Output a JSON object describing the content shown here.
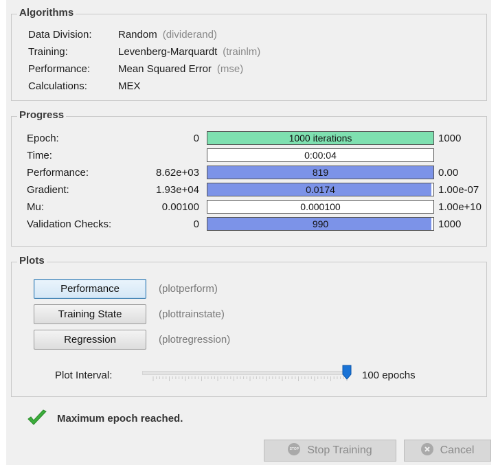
{
  "algorithms": {
    "title": "Algorithms",
    "rows": [
      {
        "key": "Data Division:",
        "value": "Random",
        "code": "(dividerand)"
      },
      {
        "key": "Training:",
        "value": "Levenberg-Marquardt",
        "code": "(trainlm)"
      },
      {
        "key": "Performance:",
        "value": "Mean Squared Error",
        "code": "(mse)"
      },
      {
        "key": "Calculations:",
        "value": "MEX",
        "code": ""
      }
    ]
  },
  "progress": {
    "title": "Progress",
    "rows": [
      {
        "label": "Epoch:",
        "start": "0",
        "bar_text": "1000 iterations",
        "end": "1000",
        "fill_fraction": 1.0,
        "fill_color": "#7ee0b0"
      },
      {
        "label": "Time:",
        "start": "",
        "bar_text": "0:00:04",
        "end": "",
        "fill_fraction": 0.0,
        "fill_color": "#ffffff"
      },
      {
        "label": "Performance:",
        "start": "8.62e+03",
        "bar_text": "819",
        "end": "0.00",
        "fill_fraction": 1.0,
        "fill_color": "#7c93e8"
      },
      {
        "label": "Gradient:",
        "start": "1.93e+04",
        "bar_text": "0.0174",
        "end": "1.00e-07",
        "fill_fraction": 0.99,
        "fill_color": "#7c93e8"
      },
      {
        "label": "Mu:",
        "start": "0.00100",
        "bar_text": "0.000100",
        "end": "1.00e+10",
        "fill_fraction": 0.0,
        "fill_color": "#ffffff"
      },
      {
        "label": "Validation Checks:",
        "start": "0",
        "bar_text": "990",
        "end": "1000",
        "fill_fraction": 0.99,
        "fill_color": "#7c93e8"
      }
    ]
  },
  "plots": {
    "title": "Plots",
    "buttons": [
      {
        "label": "Performance",
        "fn": "(plotperform)"
      },
      {
        "label": "Training State",
        "fn": "(plottrainstate)"
      },
      {
        "label": "Regression",
        "fn": "(plotregression)"
      }
    ],
    "interval_label": "Plot Interval:",
    "interval_value": "100 epochs",
    "slider_fraction": 1.0
  },
  "status": {
    "message": "Maximum epoch reached.",
    "accent": "#3cae3c"
  },
  "footer": {
    "stop_label": "Stop Training",
    "stop_icon_text": "STOP",
    "cancel_label": "Cancel"
  }
}
